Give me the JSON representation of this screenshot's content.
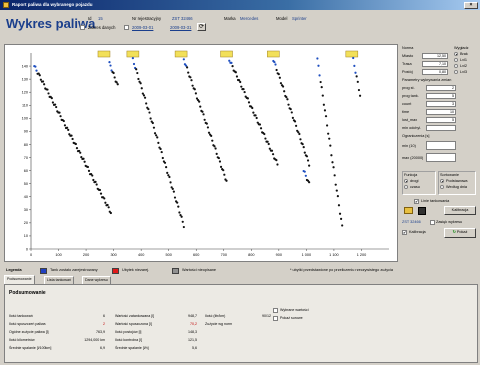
{
  "window": {
    "title": "Raport paliwa dla wybranego pojazdu"
  },
  "header": {
    "title": "Wykres paliwa",
    "id_label": "Id",
    "id_value": "15",
    "nr_label": "Nr rejestracyjny",
    "nr_value": "ZST 32466",
    "marka_label": "Marka",
    "marka_value": "Mercedes",
    "model_label": "Model",
    "model_value": "Sprinter",
    "range_label": "Zakres danych",
    "date_from": "2009-03-01",
    "date_to": "2009-03-31"
  },
  "chart_data": {
    "type": "scatter",
    "title": "",
    "xlabel": "",
    "ylabel": "",
    "xlim": [
      0,
      1300
    ],
    "ylim": [
      0,
      150
    ],
    "x_ticks": [
      0,
      100,
      200,
      300,
      400,
      500,
      600,
      700,
      800,
      900,
      1000,
      1100,
      1200
    ],
    "x_tick_labels": [
      "0",
      "100",
      "200",
      "300",
      "400",
      "500",
      "600",
      "700",
      "800",
      "900",
      "1 000",
      "1 100",
      "1 200"
    ],
    "y_ticks": [
      0,
      10,
      20,
      30,
      40,
      50,
      60,
      70,
      80,
      90,
      100,
      110,
      120,
      130,
      140
    ],
    "grid": false,
    "marker_color": "#111111",
    "marker_alt_color": "#1f4fc0",
    "refuel_color": "#f2e05a",
    "segments": [
      {
        "x0": 12,
        "y0": 140,
        "x1": 290,
        "y1": 28
      },
      {
        "x0": 285,
        "y0": 142,
        "x1": 315,
        "y1": 125
      },
      {
        "x0": 370,
        "y0": 145,
        "x1": 555,
        "y1": 18
      },
      {
        "x0": 555,
        "y0": 145,
        "x1": 710,
        "y1": 52
      },
      {
        "x0": 720,
        "y0": 145,
        "x1": 895,
        "y1": 65
      },
      {
        "x0": 880,
        "y0": 145,
        "x1": 1010,
        "y1": 65
      },
      {
        "x0": 990,
        "y0": 60,
        "x1": 1010,
        "y1": 50
      },
      {
        "x0": 1040,
        "y0": 145,
        "x1": 1130,
        "y1": 17
      },
      {
        "x0": 1170,
        "y0": 145,
        "x1": 1195,
        "y1": 118
      }
    ],
    "refuel_x": [
      265,
      370,
      545,
      710,
      880,
      1165
    ]
  },
  "right_panel": {
    "norma_label": "Norma",
    "miasto_label": "Miasto",
    "miasto_value": "12,50",
    "trasa_label": "Trasa",
    "trasa_value": "7,10",
    "postoj_label": "Postój",
    "postoj_value": "0,80",
    "wygl_label": "Wygładz",
    "wygl_options": [
      "Brak",
      "Lvl1",
      "Lvl2",
      "Lvl3"
    ],
    "wygl_selected": 0,
    "params_label": "Parametry wykrywania zmian",
    "p1_label": "prog st.",
    "p1_value": "2",
    "p2_label": "prog tank.",
    "p2_value": "5",
    "p3_label": "count",
    "p3_value": "3",
    "p4_label": "time",
    "p4_value": "10",
    "p5_label": "lost_max",
    "p5_value": "5",
    "p6_label": "min odchyl.",
    "p6_value": "",
    "lim_label": "Ograniczenia [s]",
    "min_label": "min (10)",
    "min_value": "",
    "max_label": "max (20000)",
    "max_value": "",
    "fun_label": "Funkcja",
    "fun_options": [
      "drogi",
      "czasu"
    ],
    "fun_selected": 0,
    "sort_label": "Sortowanie",
    "sort_options": [
      "Podstawowa",
      "Według dnia"
    ],
    "sort_selected": 0,
    "linie_label": "Linie tankowania",
    "linie_checked": "✔",
    "kalibr_btn": "Kalibracja",
    "bottom_text": "ZST 32466",
    "bottom_text2": "Zasięk wykresu",
    "kalibr2_label": "Kalibracja",
    "pokaz_btn": "Pokaż"
  },
  "legend": {
    "label": "Legenda",
    "items": [
      {
        "label": "Tank zostało zarejestrowany",
        "color": "#2040c0"
      },
      {
        "label": "Ubytek niezarej.",
        "color": "#e01818"
      },
      {
        "label": "Wartości nieopisane",
        "color": "#909090"
      }
    ],
    "note": "* ubytki przedstawione po przeliczeniu rzeczywistego zużycia"
  },
  "tabs": [
    {
      "label": "Podsumowanie"
    },
    {
      "label": "Lista tankowań"
    },
    {
      "label": "Dane wykresu"
    }
  ],
  "stats": {
    "title": "Podsumowanie",
    "col1": [
      {
        "label": "Ilość tankowań",
        "value": "6"
      },
      {
        "label": "Ilość spuszczeń paliwa",
        "value": "2"
      },
      {
        "label": "Ogólne zużycie paliwa [l]",
        "value": "763,9"
      },
      {
        "label": "Ilość kilometrów",
        "value": "1294,000 km"
      },
      {
        "label": "Średnie spalanie [l/100km]",
        "value": "6,9"
      }
    ],
    "col2": [
      {
        "label": "Wartość zatankowana [l]",
        "value": "948,7"
      },
      {
        "label": "Wartość spuszczona [l]",
        "value": "70,2"
      },
      {
        "label": "Ilość postojów [l]",
        "value": "148,3"
      },
      {
        "label": "Ilość kontrolna [l]",
        "value": "121,5"
      },
      {
        "label": "Średnie spalanie [l/h]",
        "value": "5,6"
      }
    ],
    "col3": [
      {
        "label": "Ilość (litr/km)",
        "value": "90/12"
      },
      {
        "label": "Zużycie wg norm",
        "value": ""
      }
    ],
    "check1": "Wybrane wartości",
    "check2": "Pokaż surowe"
  }
}
